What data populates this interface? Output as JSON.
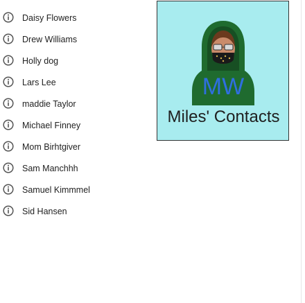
{
  "contacts": [
    {
      "name": "Daisy Flowers",
      "icon": "info-icon"
    },
    {
      "name": "Drew Williams",
      "icon": "info-icon"
    },
    {
      "name": "Holly dog",
      "icon": "info-icon"
    },
    {
      "name": "Lars Lee",
      "icon": "info-icon"
    },
    {
      "name": "maddie Taylor",
      "icon": "info-icon"
    },
    {
      "name": "Michael Finney",
      "icon": "info-icon"
    },
    {
      "name": "Mom Birhtgiver",
      "icon": "info-icon"
    },
    {
      "name": "Sam Manchhh",
      "icon": "info-icon"
    },
    {
      "name": "Samuel Kimmmel",
      "icon": "info-icon"
    },
    {
      "name": "Sid Hansen",
      "icon": "info-icon"
    }
  ],
  "header": {
    "title": "Miles' Contacts",
    "avatar_initials": "MW",
    "card_color": "#a8ecef",
    "avatar_color": "#1f6b2f",
    "initials_color": "#2f6fe0"
  }
}
